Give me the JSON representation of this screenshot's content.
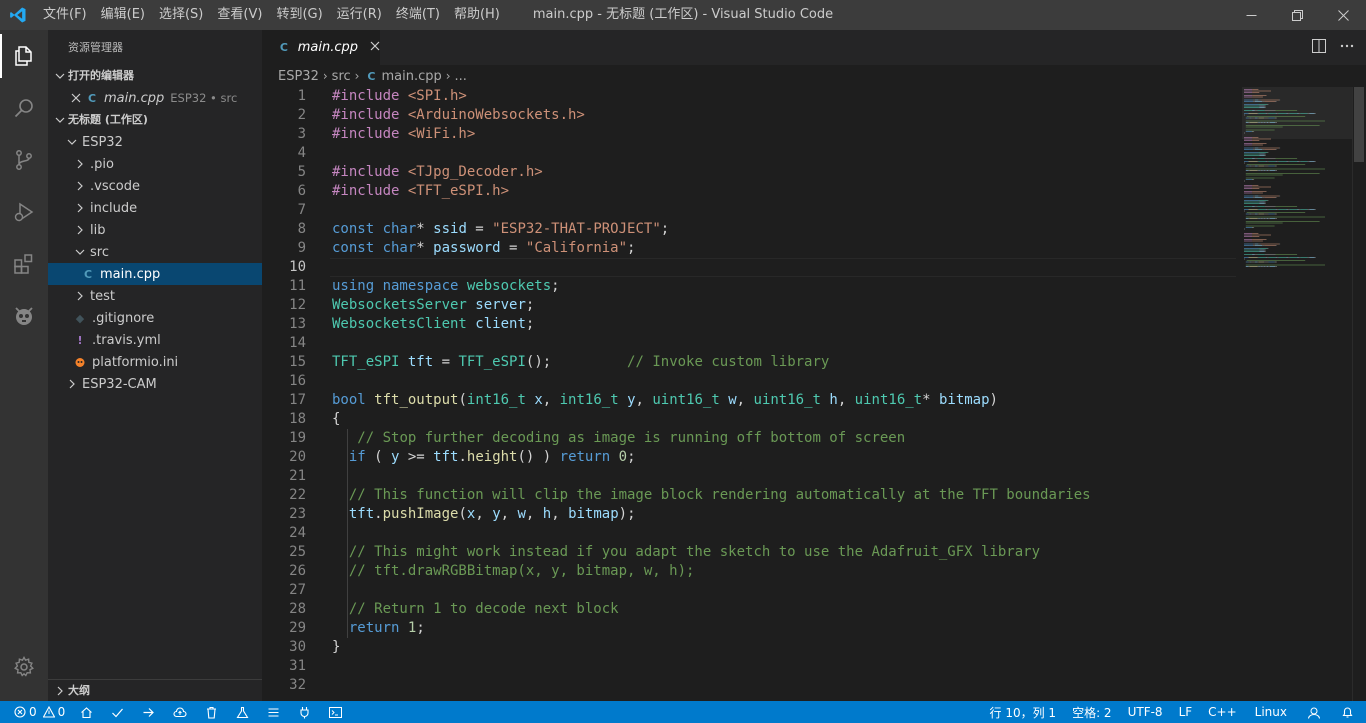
{
  "titlebar": {
    "menu": [
      "文件(F)",
      "编辑(E)",
      "选择(S)",
      "查看(V)",
      "转到(G)",
      "运行(R)",
      "终端(T)",
      "帮助(H)"
    ],
    "window_title": "main.cpp - 无标题 (工作区) - Visual Studio Code"
  },
  "activitybar": {
    "icons": [
      "explorer-icon",
      "search-icon",
      "source-control-icon",
      "run-debug-icon",
      "extensions-icon",
      "platformio-icon"
    ],
    "settings_icon": "settings-gear-icon"
  },
  "sidebar": {
    "title": "资源管理器",
    "open_editors": {
      "header": "打开的编辑器",
      "file": "main.cpp",
      "desc": "ESP32 • src"
    },
    "workspace": {
      "header": "无标题 (工作区)",
      "items": [
        {
          "label": "ESP32",
          "depth": 1,
          "kind": "folder-open"
        },
        {
          "label": ".pio",
          "depth": 2,
          "kind": "folder"
        },
        {
          "label": ".vscode",
          "depth": 2,
          "kind": "folder"
        },
        {
          "label": "include",
          "depth": 2,
          "kind": "folder"
        },
        {
          "label": "lib",
          "depth": 2,
          "kind": "folder"
        },
        {
          "label": "src",
          "depth": 2,
          "kind": "folder-open"
        },
        {
          "label": "main.cpp",
          "depth": 3,
          "kind": "cpp"
        },
        {
          "label": "test",
          "depth": 2,
          "kind": "folder"
        },
        {
          "label": ".gitignore",
          "depth": 2,
          "kind": "gitignore"
        },
        {
          "label": ".travis.yml",
          "depth": 2,
          "kind": "yml"
        },
        {
          "label": "platformio.ini",
          "depth": 2,
          "kind": "ini"
        },
        {
          "label": "ESP32-CAM",
          "depth": 1,
          "kind": "folder"
        }
      ]
    },
    "outline": {
      "header": "大纲"
    }
  },
  "editor": {
    "tab": {
      "label": "main.cpp"
    },
    "breadcrumb": [
      "ESP32",
      "src",
      "main.cpp",
      "..."
    ],
    "current_line": 10,
    "lines": [
      {
        "n": "1",
        "tokens": [
          [
            "pp",
            "#include "
          ],
          [
            "str",
            "<SPI.h>"
          ]
        ]
      },
      {
        "n": "2",
        "tokens": [
          [
            "pp",
            "#include "
          ],
          [
            "str",
            "<ArduinoWebsockets.h>"
          ]
        ]
      },
      {
        "n": "3",
        "tokens": [
          [
            "pp",
            "#include "
          ],
          [
            "str",
            "<WiFi.h>"
          ]
        ]
      },
      {
        "n": "4",
        "tokens": []
      },
      {
        "n": "5",
        "tokens": [
          [
            "pp",
            "#include "
          ],
          [
            "str",
            "<TJpg_Decoder.h>"
          ]
        ]
      },
      {
        "n": "6",
        "tokens": [
          [
            "pp",
            "#include "
          ],
          [
            "str",
            "<TFT_eSPI.h>"
          ]
        ]
      },
      {
        "n": "7",
        "tokens": []
      },
      {
        "n": "8",
        "tokens": [
          [
            "kw",
            "const "
          ],
          [
            "kw",
            "char"
          ],
          [
            "pl",
            "* "
          ],
          [
            "var",
            "ssid"
          ],
          [
            "pl",
            " = "
          ],
          [
            "str",
            "\"ESP32-THAT-PROJECT\""
          ],
          [
            "pl",
            ";"
          ]
        ]
      },
      {
        "n": "9",
        "tokens": [
          [
            "kw",
            "const "
          ],
          [
            "kw",
            "char"
          ],
          [
            "pl",
            "* "
          ],
          [
            "var",
            "password"
          ],
          [
            "pl",
            " = "
          ],
          [
            "str",
            "\"California\""
          ],
          [
            "pl",
            ";"
          ]
        ]
      },
      {
        "n": "10",
        "tokens": []
      },
      {
        "n": "11",
        "tokens": [
          [
            "kw",
            "using "
          ],
          [
            "kw",
            "namespace "
          ],
          [
            "ty",
            "websockets"
          ],
          [
            "pl",
            ";"
          ]
        ]
      },
      {
        "n": "12",
        "tokens": [
          [
            "ty",
            "WebsocketsServer "
          ],
          [
            "var",
            "server"
          ],
          [
            "pl",
            ";"
          ]
        ]
      },
      {
        "n": "13",
        "tokens": [
          [
            "ty",
            "WebsocketsClient "
          ],
          [
            "var",
            "client"
          ],
          [
            "pl",
            ";"
          ]
        ]
      },
      {
        "n": "14",
        "tokens": []
      },
      {
        "n": "15",
        "tokens": [
          [
            "ty",
            "TFT_eSPI "
          ],
          [
            "var",
            "tft"
          ],
          [
            "pl",
            " = "
          ],
          [
            "ty",
            "TFT_eSPI"
          ],
          [
            "pl",
            "();         "
          ],
          [
            "cm",
            "// Invoke custom library"
          ]
        ]
      },
      {
        "n": "16",
        "tokens": []
      },
      {
        "n": "17",
        "tokens": [
          [
            "kw",
            "bool "
          ],
          [
            "fn",
            "tft_output"
          ],
          [
            "pl",
            "("
          ],
          [
            "ty",
            "int16_t "
          ],
          [
            "var",
            "x"
          ],
          [
            "pl",
            ", "
          ],
          [
            "ty",
            "int16_t "
          ],
          [
            "var",
            "y"
          ],
          [
            "pl",
            ", "
          ],
          [
            "ty",
            "uint16_t "
          ],
          [
            "var",
            "w"
          ],
          [
            "pl",
            ", "
          ],
          [
            "ty",
            "uint16_t "
          ],
          [
            "var",
            "h"
          ],
          [
            "pl",
            ", "
          ],
          [
            "ty",
            "uint16_t"
          ],
          [
            "pl",
            "* "
          ],
          [
            "var",
            "bitmap"
          ],
          [
            "pl",
            ")"
          ]
        ]
      },
      {
        "n": "18",
        "tokens": [
          [
            "pl",
            "{"
          ]
        ]
      },
      {
        "n": "19",
        "tokens": [
          [
            "pl",
            "   "
          ],
          [
            "cm",
            "// Stop further decoding as image is running off bottom of screen"
          ]
        ]
      },
      {
        "n": "20",
        "tokens": [
          [
            "pl",
            "  "
          ],
          [
            "kw",
            "if "
          ],
          [
            "pl",
            "( "
          ],
          [
            "var",
            "y"
          ],
          [
            "pl",
            " >= "
          ],
          [
            "var",
            "tft"
          ],
          [
            "pl",
            "."
          ],
          [
            "fn",
            "height"
          ],
          [
            "pl",
            "() ) "
          ],
          [
            "kw",
            "return "
          ],
          [
            "num",
            "0"
          ],
          [
            "pl",
            ";"
          ]
        ]
      },
      {
        "n": "21",
        "tokens": []
      },
      {
        "n": "22",
        "tokens": [
          [
            "pl",
            "  "
          ],
          [
            "cm",
            "// This function will clip the image block rendering automatically at the TFT boundaries"
          ]
        ]
      },
      {
        "n": "23",
        "tokens": [
          [
            "pl",
            "  "
          ],
          [
            "var",
            "tft"
          ],
          [
            "pl",
            "."
          ],
          [
            "fn",
            "pushImage"
          ],
          [
            "pl",
            "("
          ],
          [
            "var",
            "x"
          ],
          [
            "pl",
            ", "
          ],
          [
            "var",
            "y"
          ],
          [
            "pl",
            ", "
          ],
          [
            "var",
            "w"
          ],
          [
            "pl",
            ", "
          ],
          [
            "var",
            "h"
          ],
          [
            "pl",
            ", "
          ],
          [
            "var",
            "bitmap"
          ],
          [
            "pl",
            ");"
          ]
        ]
      },
      {
        "n": "24",
        "tokens": []
      },
      {
        "n": "25",
        "tokens": [
          [
            "pl",
            "  "
          ],
          [
            "cm",
            "// This might work instead if you adapt the sketch to use the Adafruit_GFX library"
          ]
        ]
      },
      {
        "n": "26",
        "tokens": [
          [
            "pl",
            "  "
          ],
          [
            "cm",
            "// tft.drawRGBBitmap(x, y, bitmap, w, h);"
          ]
        ]
      },
      {
        "n": "27",
        "tokens": []
      },
      {
        "n": "28",
        "tokens": [
          [
            "pl",
            "  "
          ],
          [
            "cm",
            "// Return 1 to decode next block"
          ]
        ]
      },
      {
        "n": "29",
        "tokens": [
          [
            "pl",
            "  "
          ],
          [
            "kw",
            "return "
          ],
          [
            "num",
            "1"
          ],
          [
            "pl",
            ";"
          ]
        ]
      },
      {
        "n": "30",
        "tokens": [
          [
            "pl",
            "}"
          ]
        ]
      },
      {
        "n": "31",
        "tokens": []
      },
      {
        "n": "32",
        "tokens": []
      }
    ]
  },
  "statusbar": {
    "errors": "0",
    "warnings": "0",
    "left_icons": [
      "home-icon",
      "check-icon",
      "arrow-right-icon",
      "cloud-upload-icon",
      "trash-icon",
      "flask-icon",
      "list-icon",
      "plug-icon",
      "terminal-icon"
    ],
    "cursor": "行 10，列 1",
    "indent": "空格: 2",
    "encoding": "UTF-8",
    "eol": "LF",
    "language": "C++",
    "os": "Linux"
  },
  "colors": {
    "titlebar": "#3c3c3c",
    "activitybar": "#333333",
    "sidebar": "#252526",
    "editor": "#1e1e1e",
    "statusbar": "#007acc",
    "selection": "#094771"
  }
}
